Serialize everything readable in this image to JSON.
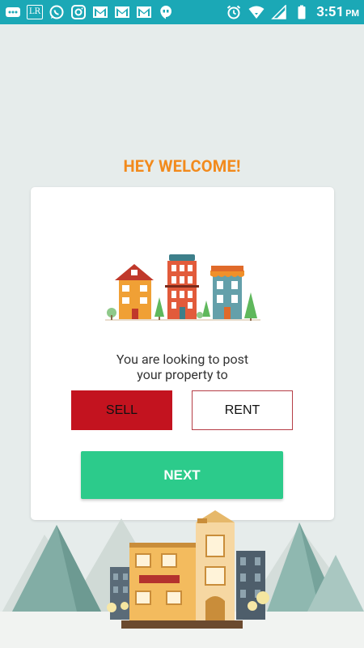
{
  "status_bar": {
    "left_icons": [
      "more-icon",
      "lr-icon",
      "whatsapp-icon",
      "instagram-icon",
      "gmail-icon",
      "gmail-icon",
      "gmail-icon",
      "hangouts-icon"
    ],
    "lr_text": "LR",
    "right_icons": [
      "alarm-icon",
      "wifi-icon",
      "signal-icon",
      "battery-icon"
    ],
    "time": "3:51",
    "ampm": "PM"
  },
  "page": {
    "title": "HEY WELCOME!",
    "prompt_line1": "You are looking to post",
    "prompt_line2": "your property to",
    "sell_label": "SELL",
    "rent_label": "RENT",
    "next_label": "NEXT",
    "selected_option": "SELL"
  },
  "colors": {
    "status_bar": "#1ba8b6",
    "title": "#f28a1c",
    "sell_selected": "#c3131f",
    "rent_border": "#b53d46",
    "next_button": "#2ccb8b",
    "background": "#e6eceb"
  }
}
